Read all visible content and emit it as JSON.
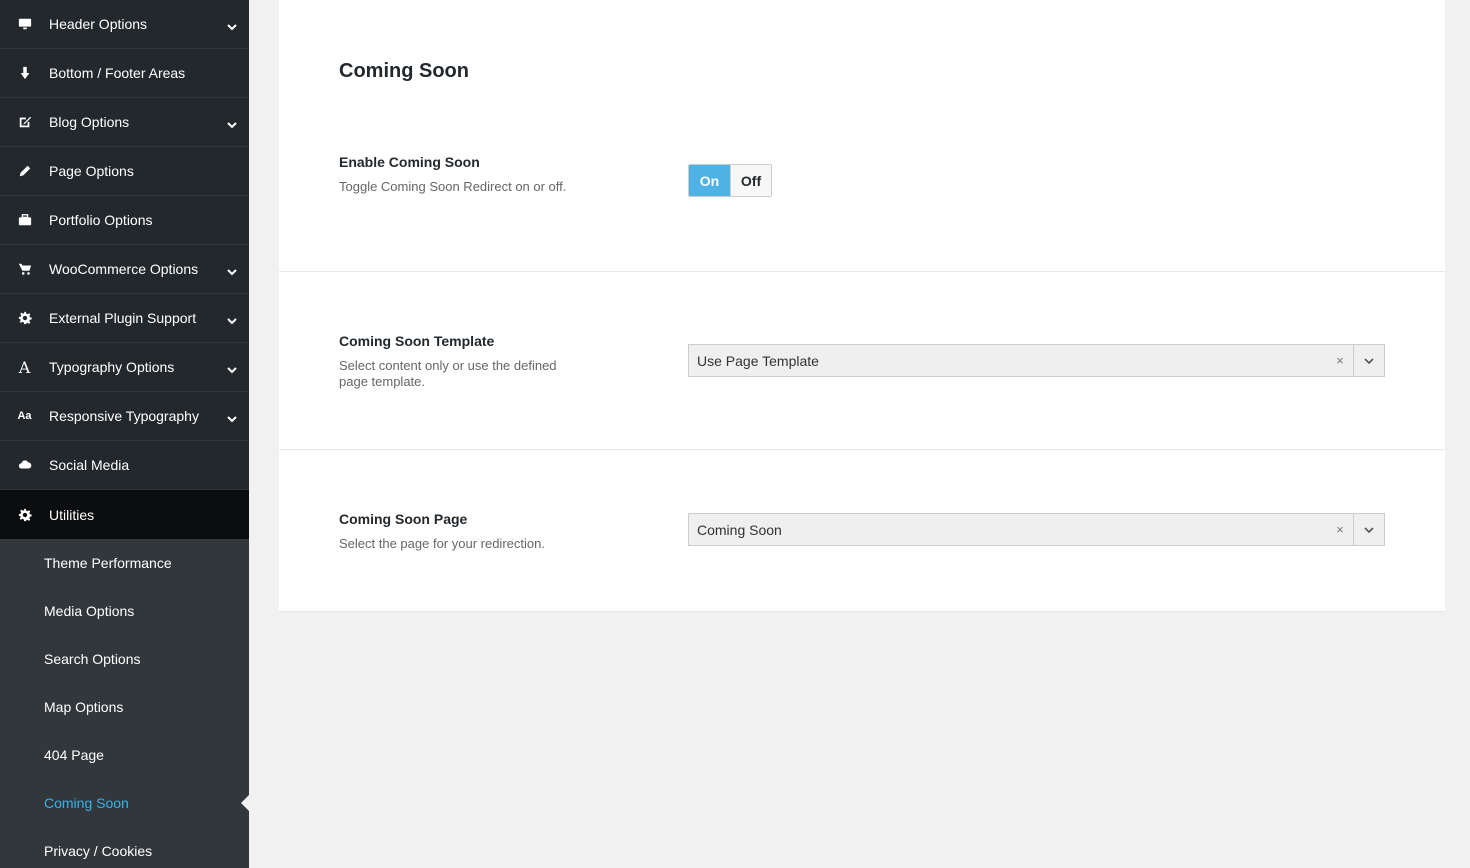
{
  "sidebar": {
    "items": [
      {
        "label": "Header Options",
        "icon": "monitor-icon",
        "chevron": true
      },
      {
        "label": "Bottom / Footer Areas",
        "icon": "arrow-down-icon",
        "chevron": false
      },
      {
        "label": "Blog Options",
        "icon": "edit-icon",
        "chevron": true
      },
      {
        "label": "Page Options",
        "icon": "pencil-icon",
        "chevron": false
      },
      {
        "label": "Portfolio Options",
        "icon": "briefcase-icon",
        "chevron": false
      },
      {
        "label": "WooCommerce Options",
        "icon": "cart-icon",
        "chevron": true
      },
      {
        "label": "External Plugin Support",
        "icon": "gear-icon",
        "chevron": true
      },
      {
        "label": "Typography Options",
        "icon": "font-icon",
        "chevron": true
      },
      {
        "label": "Responsive Typography",
        "icon": "text-size-icon",
        "chevron": true
      },
      {
        "label": "Social Media",
        "icon": "cloud-icon",
        "chevron": false
      },
      {
        "label": "Utilities",
        "icon": "gear-icon",
        "chevron": false
      }
    ],
    "submenu": [
      {
        "label": "Theme Performance"
      },
      {
        "label": "Media Options"
      },
      {
        "label": "Search Options"
      },
      {
        "label": "Map Options"
      },
      {
        "label": "404 Page"
      },
      {
        "label": "Coming Soon"
      },
      {
        "label": "Privacy / Cookies"
      }
    ]
  },
  "main": {
    "title": "Coming Soon",
    "enable": {
      "title": "Enable Coming Soon",
      "desc": "Toggle Coming Soon Redirect on or off.",
      "on_label": "On",
      "off_label": "Off"
    },
    "template": {
      "title": "Coming Soon Template",
      "desc": "Select content only or use the defined page template.",
      "value": "Use Page Template",
      "clear": "×"
    },
    "page": {
      "title": "Coming Soon Page",
      "desc": "Select the page for your redirection.",
      "value": "Coming Soon",
      "clear": "×"
    }
  },
  "colors": {
    "sidebar_bg": "#23282d",
    "active_bg": "#0c0d0e",
    "submenu_bg": "#32373c",
    "accent": "#33b3ec",
    "toggle_on": "#4fb2e5"
  }
}
